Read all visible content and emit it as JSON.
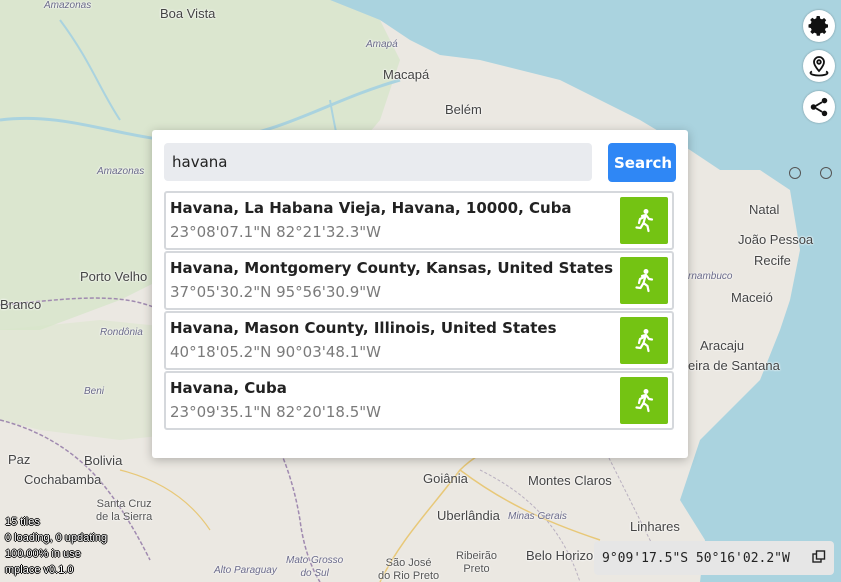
{
  "map": {
    "labels": {
      "amazonas_top": "Amazonas",
      "boa_vista": "Boa Vista",
      "amapa": "Amapá",
      "macapa": "Macapá",
      "belem": "Belém",
      "amazonas_mid": "Amazonas",
      "natal": "Natal",
      "joao_pessoa": "João Pessoa",
      "recife": "Recife",
      "porto_velho": "Porto Velho",
      "pernambuco": "rnambuco",
      "maceio": "Maceió",
      "rio_branco": "Branco",
      "rondonia": "Rondônia",
      "aracaju": "Aracaju",
      "feira": "eira de Santana",
      "beni": "Beni",
      "bolivia": "Bolivia",
      "paz": "Paz",
      "cochabamba": "Cochabamba",
      "santa_cruz": "Santa Cruz\nde la Sierra",
      "goiania": "Goiânia",
      "montes_claros": "Montes Claros",
      "uberlandia": "Uberlândia",
      "minas": "Minas Gerais",
      "linhares": "Linhares",
      "mato_grosso": "Mato Grosso\ndo Sul",
      "alto_paraguay": "Alto Paraguay",
      "sao_jose": "São José\ndo Rio Preto",
      "ribeirao": "Ribeirão\nPreto",
      "belo_horizonte": "Belo Horizont"
    }
  },
  "toolbar": {
    "settings_icon": "gear-icon",
    "location_icon": "map-pin-icon",
    "share_icon": "share-icon"
  },
  "search": {
    "query": "havana",
    "button_label": "Search",
    "results": [
      {
        "name": "Havana, La Habana Vieja, Havana, 10000, Cuba",
        "coord": "23°08'07.1\"N 82°21'32.3\"W"
      },
      {
        "name": "Havana, Montgomery County, Kansas, United States",
        "coord": "37°05'30.2\"N 95°56'30.9\"W"
      },
      {
        "name": "Havana, Mason County, Illinois, United States",
        "coord": "40°18'05.2\"N 90°03'48.1\"W"
      },
      {
        "name": "Havana, Cuba",
        "coord": "23°09'35.1\"N 82°20'18.5\"W"
      }
    ]
  },
  "stats": {
    "tiles": "15 tiles",
    "loading": "0 loading, 0 updating",
    "usage": "100.00% in use",
    "version": "mplace v0.1.0"
  },
  "coords": {
    "text": "9°09'17.5\"S 50°16'02.2\"W"
  },
  "colors": {
    "accent": "#2f87f5",
    "go": "#74c313",
    "ocean": "#aad3df",
    "land": "#e8e6e2"
  }
}
